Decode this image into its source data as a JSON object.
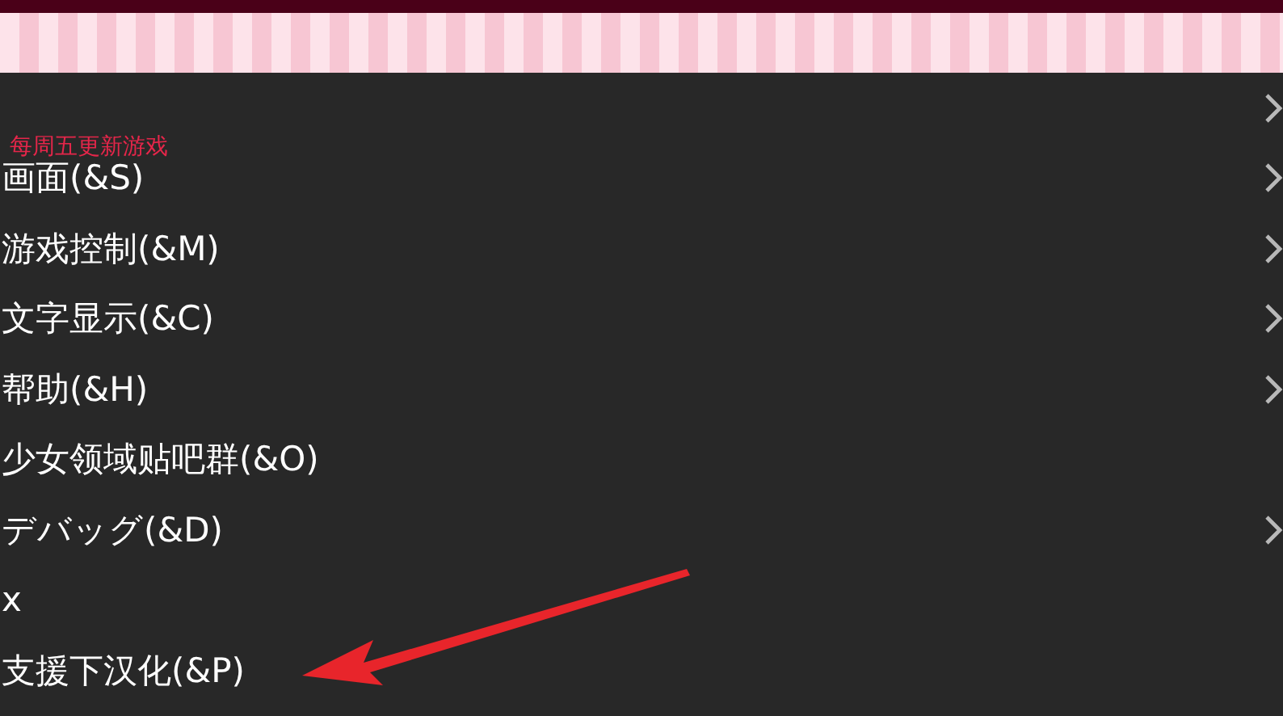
{
  "notice": "每周五更新游戏",
  "menu": [
    {
      "has_submenu": true
    },
    {
      "label": "画面(&S)",
      "has_submenu": true
    },
    {
      "label": "游戏控制(&M)",
      "has_submenu": true
    },
    {
      "label": "文字显示(&C)",
      "has_submenu": true
    },
    {
      "label": "帮助(&H)",
      "has_submenu": true
    },
    {
      "label": "少女领域贴吧群(&O)",
      "has_submenu": false
    },
    {
      "label": "デバッグ(&D)",
      "has_submenu": true
    },
    {
      "label": "x",
      "has_submenu": false
    },
    {
      "label": "支援下汉化(&P)",
      "has_submenu": false
    }
  ]
}
